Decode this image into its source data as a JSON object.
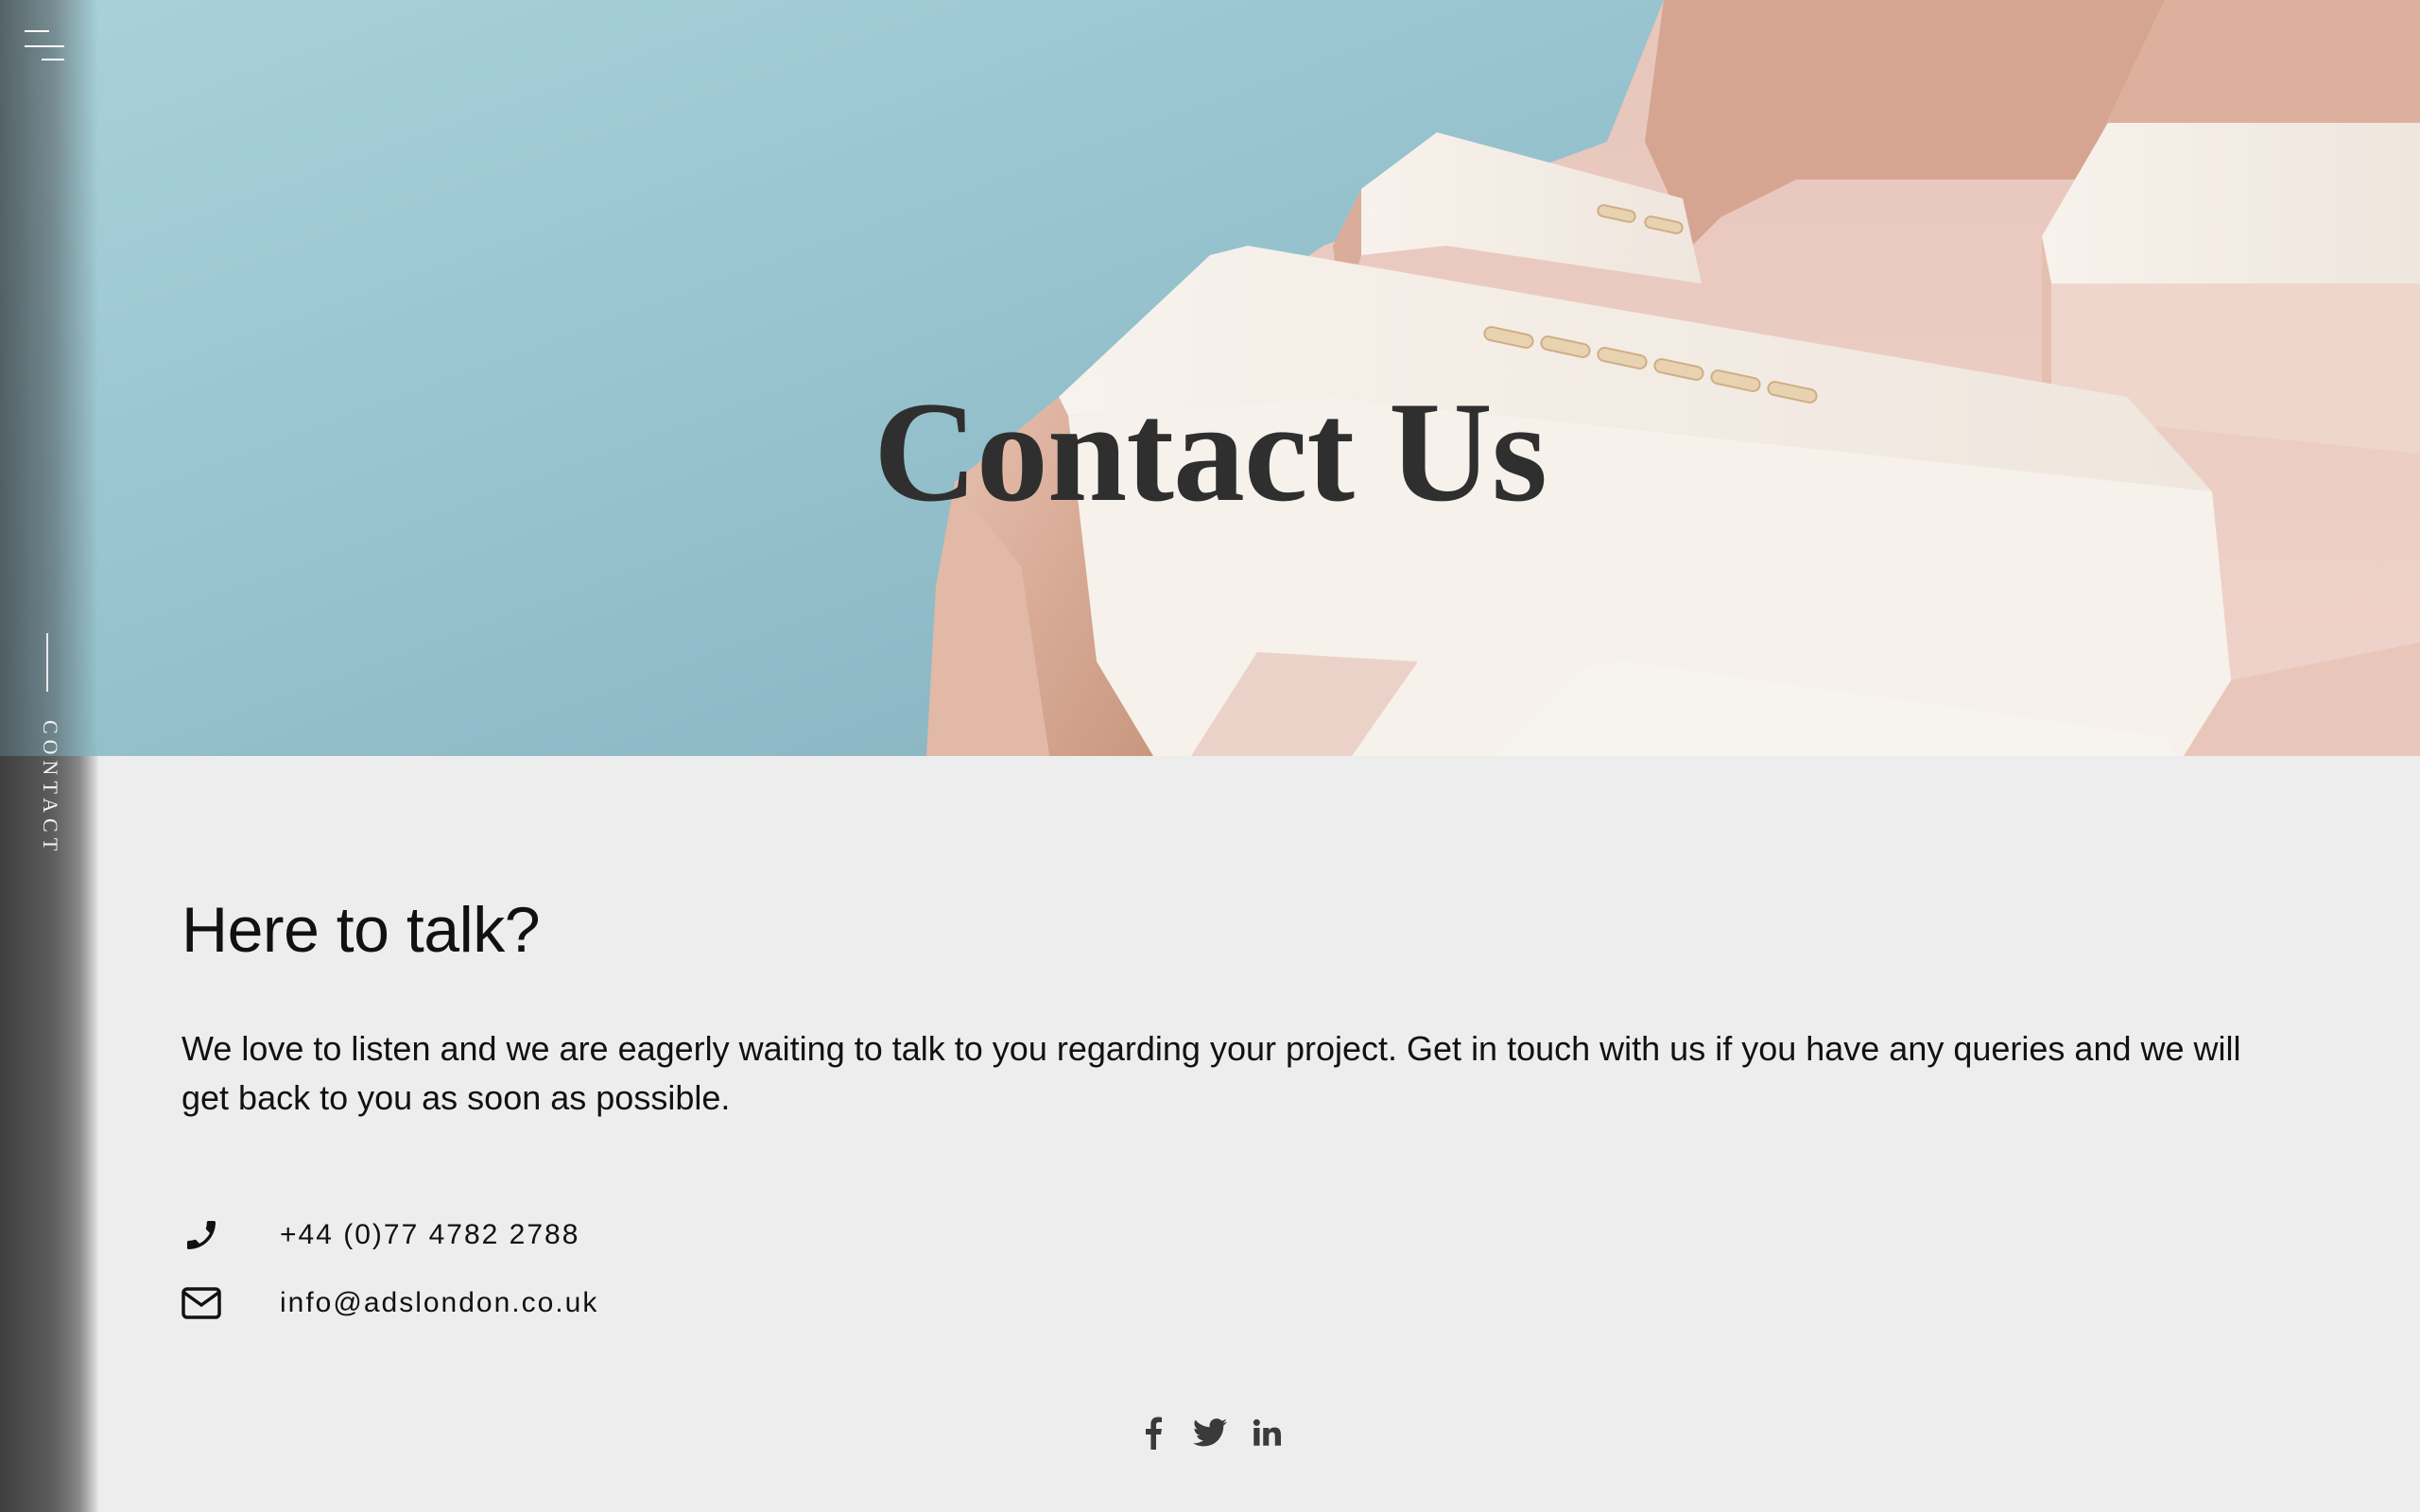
{
  "hero": {
    "title": "Contact Us"
  },
  "sidebar": {
    "menu_icon": "hamburger-menu-icon",
    "section_label": "CONTACT"
  },
  "main": {
    "heading": "Here to talk?",
    "intro": "We love to listen and we are eagerly waiting to talk to you regarding your project. Get in touch with us if you have any queries and we will get back to you as soon as possible."
  },
  "contact": {
    "phone": {
      "icon": "phone-icon",
      "value": "+44 (0)77 4782 2788"
    },
    "email": {
      "icon": "envelope-icon",
      "value": "info@adslondon.co.uk"
    }
  },
  "social": [
    {
      "icon": "facebook-icon"
    },
    {
      "icon": "twitter-icon"
    },
    {
      "icon": "linkedin-icon"
    }
  ],
  "colors": {
    "background": "#ededed",
    "sky": "#9cc6d1",
    "building": "#f3ece6",
    "building_shadow": "#e2b8a6",
    "text": "#111111",
    "title": "#2f2f2f"
  }
}
